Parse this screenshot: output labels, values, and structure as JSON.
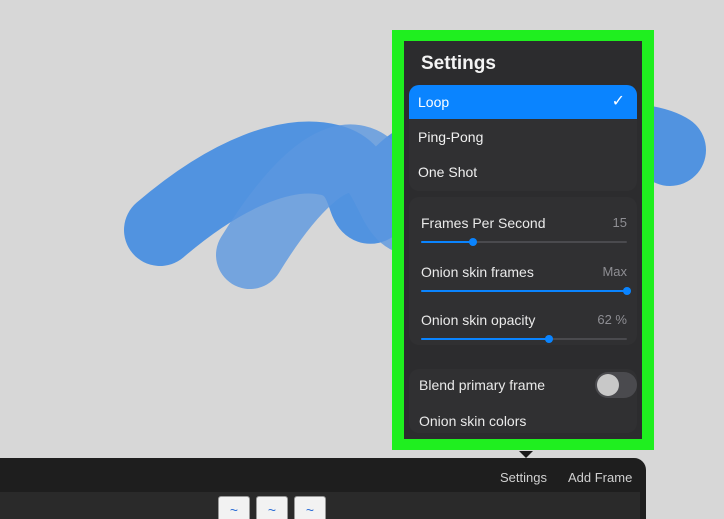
{
  "settings": {
    "title": "Settings",
    "modes": [
      {
        "label": "Loop",
        "selected": true,
        "check": "✓"
      },
      {
        "label": "Ping-Pong",
        "selected": false
      },
      {
        "label": "One Shot",
        "selected": false
      }
    ],
    "sliders": [
      {
        "label": "Frames Per Second",
        "value": "15",
        "fraction": 0.25
      },
      {
        "label": "Onion skin frames",
        "value": "Max",
        "fraction": 1.0
      },
      {
        "label": "Onion skin opacity",
        "value": "62 %",
        "fraction": 0.62
      }
    ],
    "blend_primary_frame": {
      "label": "Blend primary frame",
      "on": false
    },
    "onion_skin_colors": {
      "label": "Onion skin colors"
    }
  },
  "timeline": {
    "settings_label": "Settings",
    "add_frame_label": "Add Frame",
    "frames": [
      {
        "glyph": "~"
      },
      {
        "glyph": "~"
      },
      {
        "glyph": "~"
      }
    ]
  },
  "colors": {
    "accent": "#0a84ff",
    "highlight": "#1fef1f",
    "stroke": "#4a90e2"
  }
}
